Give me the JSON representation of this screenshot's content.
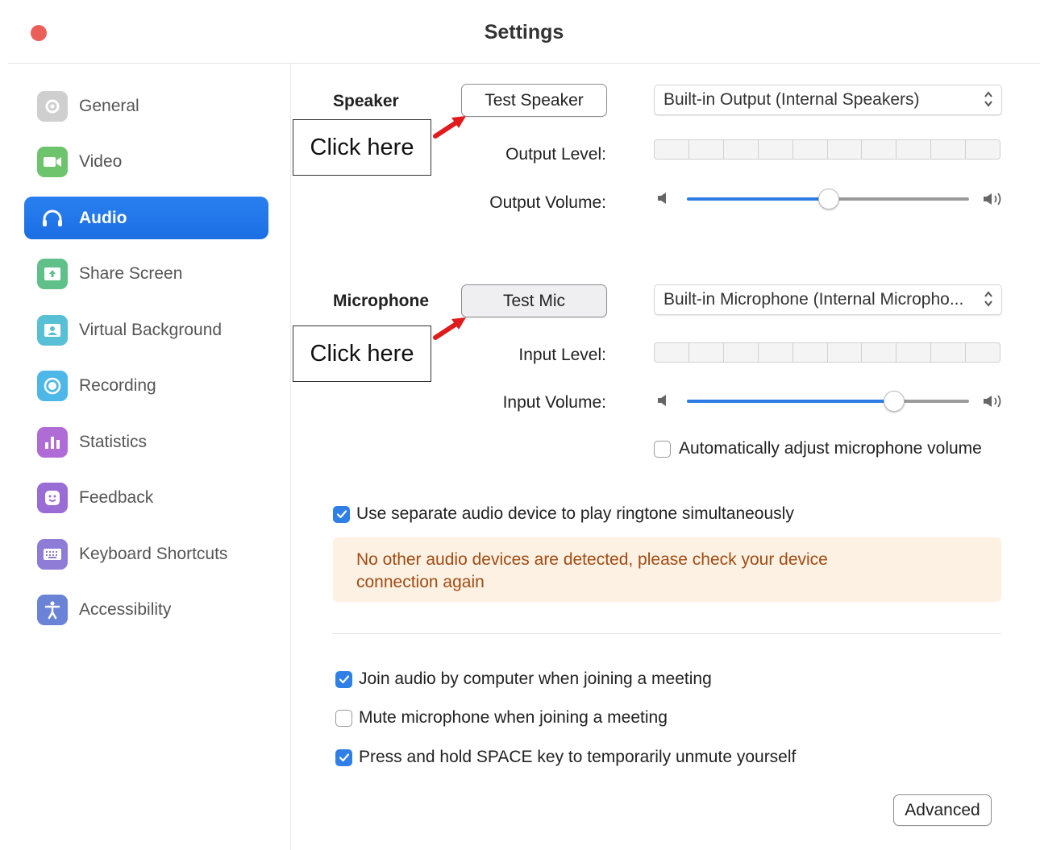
{
  "window": {
    "title": "Settings"
  },
  "sidebar": {
    "items": [
      {
        "label": "General",
        "icon": "gear-icon",
        "color": "#c8c8c8",
        "active": false
      },
      {
        "label": "Video",
        "icon": "video-camera-icon",
        "color": "#6dc46d",
        "active": false
      },
      {
        "label": "Audio",
        "icon": "headphones-icon",
        "color": "#1a73e8",
        "active": true
      },
      {
        "label": "Share Screen",
        "icon": "share-screen-icon",
        "color": "#5fc08a",
        "active": false
      },
      {
        "label": "Virtual Background",
        "icon": "virtual-background-icon",
        "color": "#58c0d4",
        "active": false
      },
      {
        "label": "Recording",
        "icon": "recording-icon",
        "color": "#4db7e8",
        "active": false
      },
      {
        "label": "Statistics",
        "icon": "statistics-icon",
        "color": "#b06cd6",
        "active": false
      },
      {
        "label": "Feedback",
        "icon": "feedback-smile-icon",
        "color": "#9a6cd6",
        "active": false
      },
      {
        "label": "Keyboard Shortcuts",
        "icon": "keyboard-icon",
        "color": "#8e7cd6",
        "active": false
      },
      {
        "label": "Accessibility",
        "icon": "accessibility-icon",
        "color": "#6b83d6",
        "active": false
      }
    ]
  },
  "speaker": {
    "section_label": "Speaker",
    "test_button": "Test Speaker",
    "device": "Built-in Output (Internal Speakers)",
    "output_level_label": "Output Level:",
    "output_volume_label": "Output Volume:",
    "output_volume_fraction": 0.5
  },
  "microphone": {
    "section_label": "Microphone",
    "test_button": "Test Mic",
    "device": "Built-in Microphone (Internal Micropho...",
    "input_level_label": "Input Level:",
    "input_volume_label": "Input Volume:",
    "input_volume_fraction": 0.73,
    "auto_adjust_label": "Automatically adjust microphone volume",
    "auto_adjust_checked": false
  },
  "annotations": {
    "speaker_callout": "Click here",
    "mic_callout": "Click here"
  },
  "ringtone": {
    "label": "Use separate audio device to play ringtone simultaneously",
    "checked": true,
    "notice": "No other audio devices are detected, please check your device connection again"
  },
  "options": [
    {
      "label": "Join audio by computer when joining a meeting",
      "checked": true
    },
    {
      "label": "Mute microphone when joining a meeting",
      "checked": false
    },
    {
      "label": "Press and hold SPACE key to temporarily unmute yourself",
      "checked": true
    }
  ],
  "advanced_button": "Advanced",
  "colors": {
    "accent": "#1a73e8",
    "close_dot": "#ec5f59",
    "notice_bg": "#fdf1e3",
    "notice_text": "#a14b12",
    "callout_arrow": "#e01b1b"
  }
}
